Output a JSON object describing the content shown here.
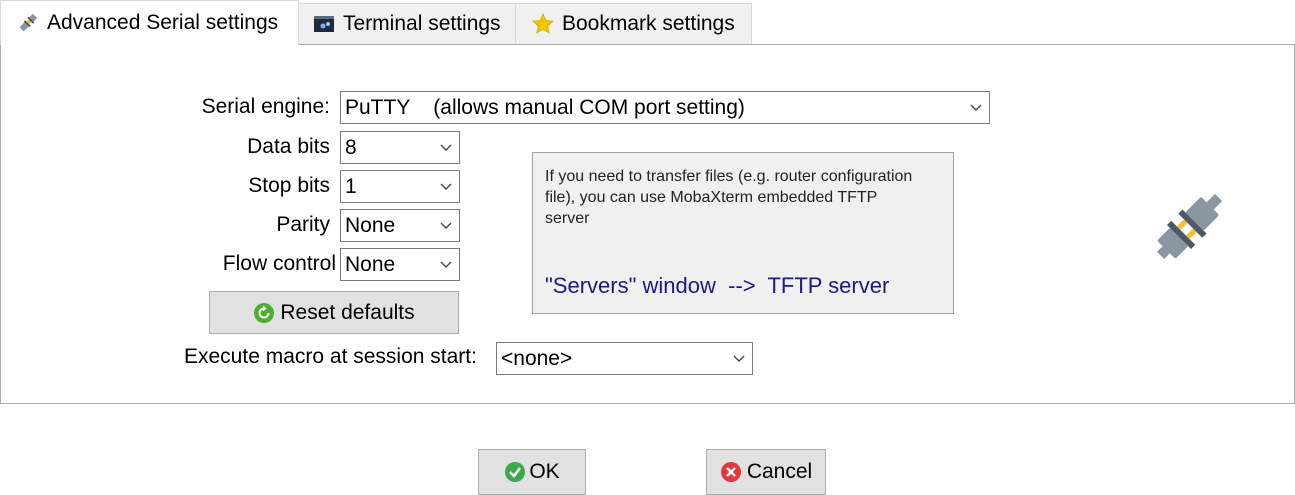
{
  "tabs": [
    {
      "label": "Advanced Serial settings",
      "icon": "serial-plug-icon",
      "active": true
    },
    {
      "label": "Terminal settings",
      "icon": "terminal-icon",
      "active": false
    },
    {
      "label": "Bookmark settings",
      "icon": "star-icon",
      "active": false
    }
  ],
  "form": {
    "serial_engine_label": "Serial engine:",
    "serial_engine_value": "PuTTY    (allows manual COM port setting)",
    "data_bits_label": "Data bits",
    "data_bits_value": "8",
    "stop_bits_label": "Stop bits",
    "stop_bits_value": "1",
    "parity_label": "Parity",
    "parity_value": "None",
    "flow_control_label": "Flow control",
    "flow_control_value": "None",
    "reset_label": "Reset defaults",
    "macro_label": "Execute macro at session start:",
    "macro_value": "<none>"
  },
  "info_box": {
    "text": "If you need to transfer files (e.g. router configuration file), you can use MobaXterm embedded TFTP server",
    "link": "\"Servers\" window  -->  TFTP server"
  },
  "dialog_buttons": {
    "ok_label": "OK",
    "cancel_label": "Cancel"
  },
  "colors": {
    "star": "#f5c400",
    "ok_green": "#3aa84b",
    "cancel_red": "#e0383e",
    "reset_green": "#4caf30",
    "link_blue": "#1a1a80"
  }
}
